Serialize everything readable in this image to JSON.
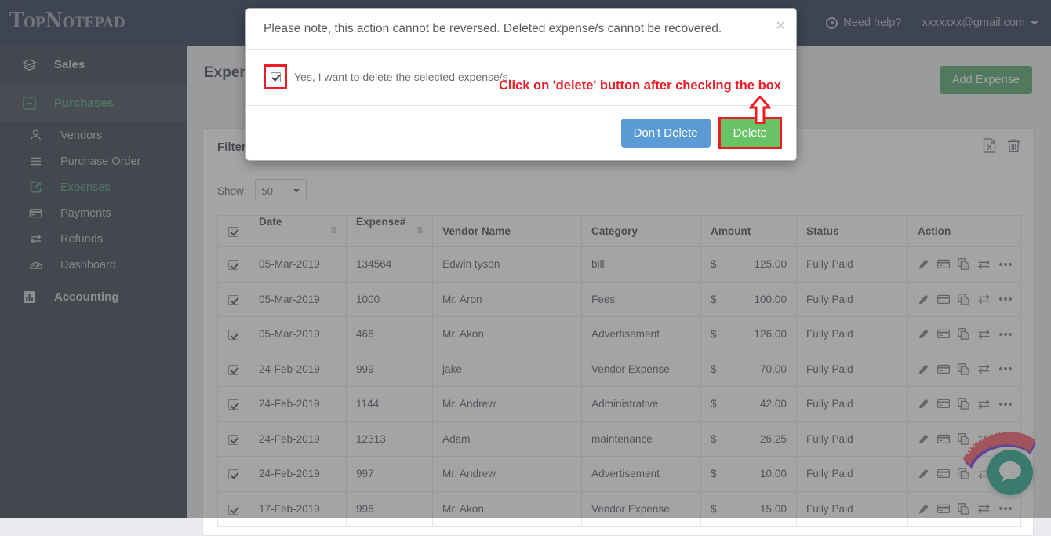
{
  "navbar": {
    "brand": "TopNotepad",
    "help_label": "Need help?",
    "account_label": "xxxxxxx@gmail.com"
  },
  "sidebar": {
    "groups": [
      {
        "label": "Sales",
        "icon": "layers-icon",
        "active": false
      },
      {
        "label": "Purchases",
        "icon": "minus-box-icon",
        "active": true
      },
      {
        "label": "Accounting",
        "icon": "bar-chart-icon",
        "active": false
      }
    ],
    "items": [
      {
        "label": "Vendors",
        "icon": "user-icon",
        "active": false
      },
      {
        "label": "Purchase Order",
        "icon": "list-icon",
        "active": false
      },
      {
        "label": "Expenses",
        "icon": "share-box-icon",
        "active": true
      },
      {
        "label": "Payments",
        "icon": "credit-card-icon",
        "active": false
      },
      {
        "label": "Refunds",
        "icon": "exchange-icon",
        "active": false
      },
      {
        "label": "Dashboard",
        "icon": "gauge-icon",
        "active": false
      }
    ]
  },
  "page": {
    "title": "Expenses",
    "add_button": "Add Expense",
    "panel_title": "Filter",
    "export_icon": "excel-export-icon",
    "delete_icon": "trash-icon",
    "show_label": "Show:",
    "show_value": "50",
    "accent_green": "#45a163",
    "accent_blue": "#5b9bd5",
    "accent_red": "#ee1c25"
  },
  "table": {
    "columns": [
      {
        "key": "check",
        "label": ""
      },
      {
        "key": "date",
        "label": "Date",
        "sortable": true
      },
      {
        "key": "expense",
        "label": "Expense#",
        "sortable": true
      },
      {
        "key": "vendor",
        "label": "Vendor Name",
        "sortable": false
      },
      {
        "key": "category",
        "label": "Category",
        "sortable": false
      },
      {
        "key": "amount",
        "label": "Amount",
        "sortable": false
      },
      {
        "key": "status",
        "label": "Status",
        "sortable": false
      },
      {
        "key": "action",
        "label": "Action",
        "sortable": false
      }
    ],
    "header_checked": true,
    "currency": "$",
    "action_icons": [
      "pencil-icon",
      "credit-card-icon",
      "copy-icon",
      "exchange-icon",
      "ellipsis-icon"
    ],
    "rows": [
      {
        "checked": true,
        "date": "05-Mar-2019",
        "expense": "134564",
        "vendor": "Edwin tyson",
        "category": "bill",
        "amount": "125.00",
        "status": "Fully Paid"
      },
      {
        "checked": true,
        "date": "05-Mar-2019",
        "expense": "1000",
        "vendor": "Mr. Aron",
        "category": "Fees",
        "amount": "100.00",
        "status": "Fully Paid"
      },
      {
        "checked": true,
        "date": "05-Mar-2019",
        "expense": "466",
        "vendor": "Mr. Akon",
        "category": "Advertisement",
        "amount": "126.00",
        "status": "Fully Paid"
      },
      {
        "checked": true,
        "date": "24-Feb-2019",
        "expense": "999",
        "vendor": "jake",
        "category": "Vendor Expense",
        "amount": "70.00",
        "status": "Fully Paid"
      },
      {
        "checked": true,
        "date": "24-Feb-2019",
        "expense": "1144",
        "vendor": "Mr. Andrew",
        "category": "Administrative",
        "amount": "42.00",
        "status": "Fully Paid"
      },
      {
        "checked": true,
        "date": "24-Feb-2019",
        "expense": "12313",
        "vendor": "Adam",
        "category": "maintenance",
        "amount": "26.25",
        "status": "Fully Paid"
      },
      {
        "checked": true,
        "date": "24-Feb-2019",
        "expense": "997",
        "vendor": "Mr. Andrew",
        "category": "Advertisement",
        "amount": "10.00",
        "status": "Fully Paid"
      },
      {
        "checked": true,
        "date": "17-Feb-2019",
        "expense": "996",
        "vendor": "Mr. Akon",
        "category": "Vendor Expense",
        "amount": "15.00",
        "status": "Fully Paid"
      }
    ]
  },
  "modal": {
    "message": "Please note, this action cannot be reversed. Deleted expense/s cannot be recovered.",
    "close_label": "×",
    "checkbox_checked": true,
    "checkbox_label": "Yes, I want to delete the selected expense/s.",
    "annotation": "Click on 'delete' button after checking the box",
    "dont_delete_label": "Don't Delete",
    "delete_label": "Delete"
  },
  "widget": {
    "badge_text": "We Are Here!",
    "chat_icon": "chat-bubble-icon",
    "badge_color": "#f4505e",
    "chat_color": "#17a589"
  }
}
